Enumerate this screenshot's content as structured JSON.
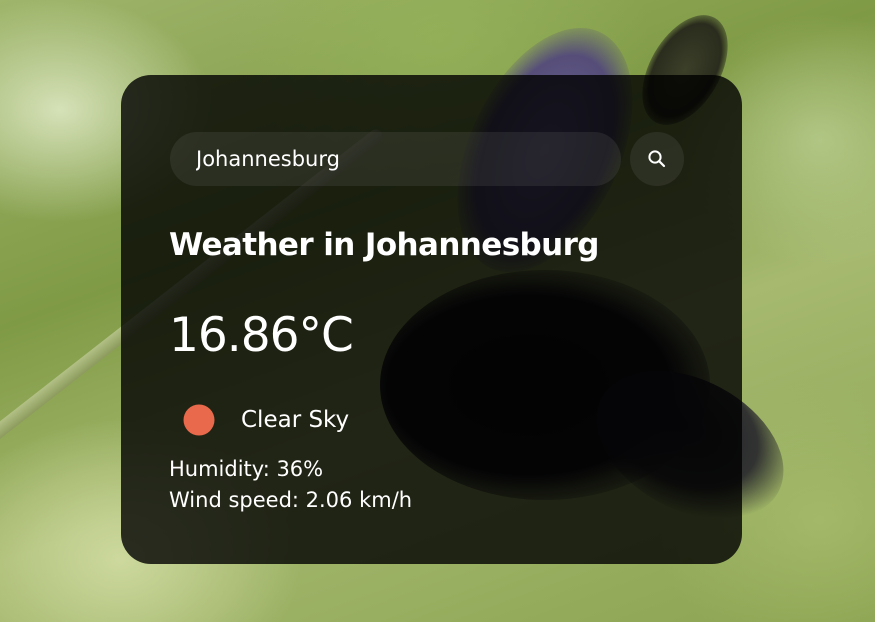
{
  "search": {
    "value": "Johannesburg",
    "button_icon": "search-icon"
  },
  "weather": {
    "title": "Weather in Johannesburg",
    "temperature": "16.86°C",
    "condition": "Clear Sky",
    "condition_icon": "sun-icon",
    "condition_icon_color": "#e8694b",
    "humidity": "Humidity: 36%",
    "wind_speed": "Wind speed: 2.06 km/h"
  },
  "colors": {
    "card_background": "rgba(0,0,0,0.8)",
    "text": "#ffffff"
  }
}
